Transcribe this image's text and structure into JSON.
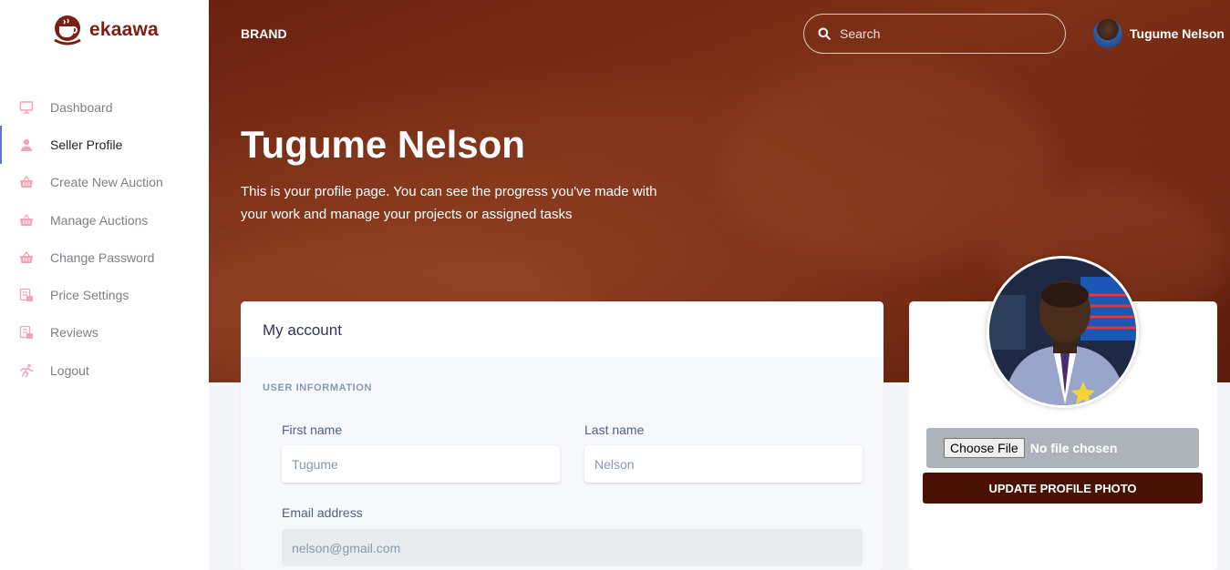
{
  "logo": {
    "text": "ekaawa",
    "brand_color": "#7a1f12"
  },
  "sidebar": {
    "items": [
      {
        "label": "Dashboard",
        "icon": "monitor-icon",
        "active": false
      },
      {
        "label": "Seller Profile",
        "icon": "user-icon",
        "active": true
      },
      {
        "label": "Create New Auction",
        "icon": "basket-icon",
        "active": false
      },
      {
        "label": "Manage Auctions",
        "icon": "basket-icon",
        "active": false
      },
      {
        "label": "Change Password",
        "icon": "basket-icon",
        "active": false
      },
      {
        "label": "Price Settings",
        "icon": "list-icon",
        "active": false
      },
      {
        "label": "Reviews",
        "icon": "list-icon",
        "active": false
      },
      {
        "label": "Logout",
        "icon": "running-icon",
        "active": false
      }
    ],
    "icon_color": "#f3a4b5",
    "active_indicator_color": "#5e72e4"
  },
  "header": {
    "brand": "BRAND",
    "search_placeholder": "Search",
    "user_name": "Tugume Nelson"
  },
  "hero": {
    "title": "Tugume Nelson",
    "text": "This is your profile page. You can see the progress you've made with your work and manage your projects or assigned tasks"
  },
  "account": {
    "title": "My account",
    "section": "USER INFORMATION",
    "first_name_label": "First name",
    "first_name_value": "Tugume",
    "last_name_label": "Last name",
    "last_name_value": "Nelson",
    "email_label": "Email address",
    "email_value": "nelson@gmail.com"
  },
  "profile_photo": {
    "choose_label": "Choose File",
    "no_file_text": "No file chosen",
    "update_label": "UPDATE PROFILE PHOTO",
    "button_color": "#4a1204"
  }
}
